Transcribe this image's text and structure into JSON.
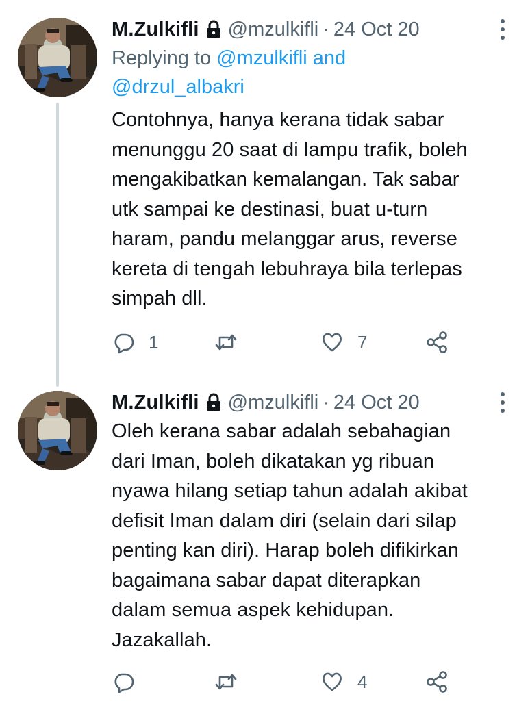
{
  "tweets": [
    {
      "display_name": "M.Zulkifli",
      "handle": "@mzulkifli",
      "separator": "·",
      "date": "24 Oct 20",
      "replying_prefix": "Replying to ",
      "replying_mention_1": "@mzulkifli",
      "replying_and": " and",
      "replying_mention_2": "@drzul_albakri",
      "text": "Contohnya, hanya kerana tidak sabar\nmenunggu 20 saat di lampu trafik, boleh\nmengakibatkan kemalangan. Tak sabar\nutk sampai ke destinasi, buat u-turn\nharam, pandu melanggar arus, reverse\nkereta di tengah lebuhraya bila terlepas\nsimpah dll.",
      "reply_count": "1",
      "retweet_count": "",
      "like_count": "7"
    },
    {
      "display_name": "M.Zulkifli",
      "handle": "@mzulkifli",
      "separator": "·",
      "date": "24 Oct 20",
      "text": "Oleh kerana sabar adalah sebahagian\ndari Iman, boleh dikatakan yg ribuan\nnyawa hilang setiap tahun adalah akibat\ndefisit Iman dalam diri (selain dari silap\npenting kan diri). Harap boleh difikirkan\nbagaimana sabar dapat diterapkan\ndalam semua aspek kehidupan.\nJazakallah.",
      "reply_count": "",
      "retweet_count": "",
      "like_count": "4"
    }
  ],
  "icons": {
    "lock": "lock-icon",
    "more": "more-vertical-icon",
    "reply": "reply-icon",
    "retweet": "retweet-icon",
    "like": "heart-icon",
    "share": "share-icon"
  },
  "colors": {
    "text": "#0f1419",
    "secondary": "#536471",
    "link": "#1d9bf0",
    "thread_line": "#cfd9de"
  }
}
